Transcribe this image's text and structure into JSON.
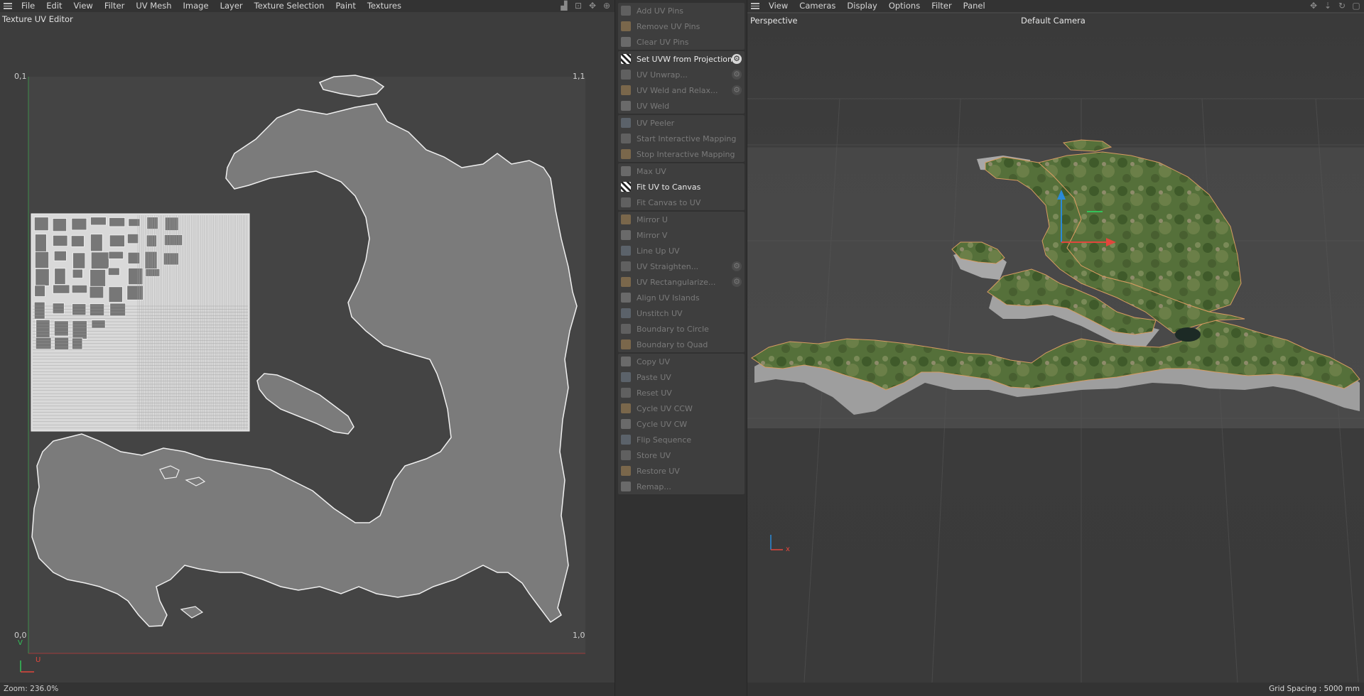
{
  "uv_editor": {
    "menu": [
      "File",
      "Edit",
      "View",
      "Filter",
      "UV Mesh",
      "Image",
      "Layer",
      "Texture Selection",
      "Paint",
      "Textures"
    ],
    "title": "Texture UV Editor",
    "corners": {
      "top_left": "0,1",
      "top_right": "1,1",
      "bottom_left": "0,0",
      "bottom_right": "1,0"
    },
    "axis_v": "V",
    "axis_u": "U",
    "zoom": "Zoom: 236.0%"
  },
  "commands": [
    {
      "label": "Add UV Pins",
      "enabled": false,
      "gear": false
    },
    {
      "label": "Remove UV Pins",
      "enabled": false,
      "gear": false
    },
    {
      "label": "Clear UV Pins",
      "enabled": false,
      "gear": false
    },
    {
      "label": "Set UVW from Projection...",
      "enabled": true,
      "gear": true
    },
    {
      "label": "UV Unwrap...",
      "enabled": false,
      "gear": true
    },
    {
      "label": "UV Weld and Relax...",
      "enabled": false,
      "gear": true
    },
    {
      "label": "UV Weld",
      "enabled": false,
      "gear": false
    },
    {
      "label": "UV Peeler",
      "enabled": false,
      "gear": false
    },
    {
      "label": "Start Interactive Mapping",
      "enabled": false,
      "gear": false
    },
    {
      "label": "Stop Interactive Mapping",
      "enabled": false,
      "gear": false
    },
    {
      "label": "Max UV",
      "enabled": false,
      "gear": false
    },
    {
      "label": "Fit UV to Canvas",
      "enabled": true,
      "gear": false
    },
    {
      "label": "Fit Canvas to UV",
      "enabled": false,
      "gear": false
    },
    {
      "label": "Mirror U",
      "enabled": false,
      "gear": false
    },
    {
      "label": "Mirror V",
      "enabled": false,
      "gear": false
    },
    {
      "label": "Line Up UV",
      "enabled": false,
      "gear": false
    },
    {
      "label": "UV Straighten...",
      "enabled": false,
      "gear": true
    },
    {
      "label": "UV Rectangularize...",
      "enabled": false,
      "gear": true
    },
    {
      "label": "Align UV Islands",
      "enabled": false,
      "gear": false
    },
    {
      "label": "Unstitch UV",
      "enabled": false,
      "gear": false
    },
    {
      "label": "Boundary to Circle",
      "enabled": false,
      "gear": false
    },
    {
      "label": "Boundary to Quad",
      "enabled": false,
      "gear": false
    },
    {
      "label": "Copy UV",
      "enabled": false,
      "gear": false
    },
    {
      "label": "Paste UV",
      "enabled": false,
      "gear": false
    },
    {
      "label": "Reset UV",
      "enabled": false,
      "gear": false
    },
    {
      "label": "Cycle UV CCW",
      "enabled": false,
      "gear": false
    },
    {
      "label": "Cycle UV CW",
      "enabled": false,
      "gear": false
    },
    {
      "label": "Flip Sequence",
      "enabled": false,
      "gear": false
    },
    {
      "label": "Store UV",
      "enabled": false,
      "gear": false
    },
    {
      "label": "Restore UV",
      "enabled": false,
      "gear": false
    },
    {
      "label": "Remap...",
      "enabled": false,
      "gear": false
    }
  ],
  "viewport": {
    "menu": [
      "View",
      "Cameras",
      "Display",
      "Options",
      "Filter",
      "Panel"
    ],
    "projection": "Perspective",
    "camera": "Default Camera",
    "grid_spacing": "Grid Spacing : 5000 mm",
    "axis_x": "x"
  },
  "colors": {
    "land_uv": "#7b7b7b",
    "outline": "#f0f0f0",
    "terrain": "#4f6a35",
    "extrusion": "#9e9e9e",
    "axis_x": "#e2463c",
    "axis_y": "#33c15a",
    "axis_z": "#2a8ad8"
  }
}
